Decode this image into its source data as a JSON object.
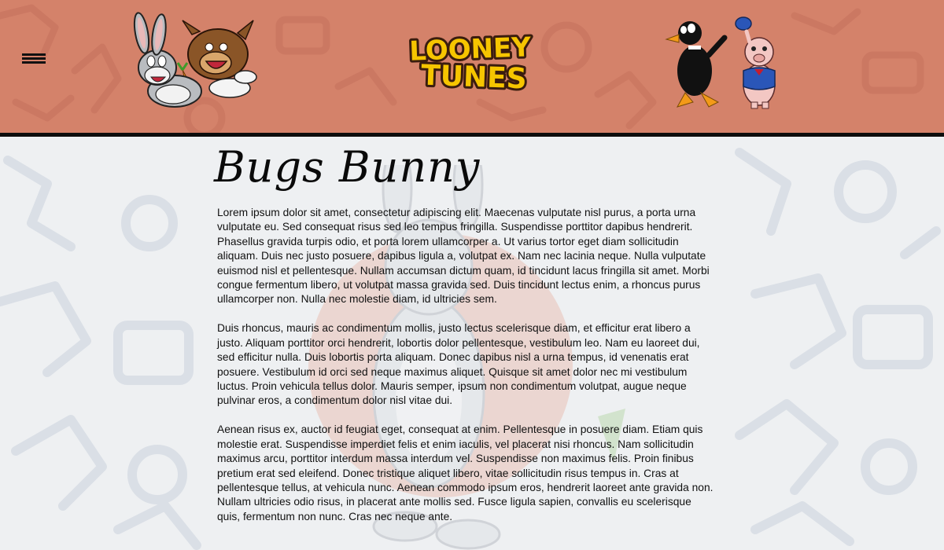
{
  "header": {
    "menu_icon": "hamburger-menu-icon",
    "logo_line1": "LOONEY",
    "logo_line2": "TUNES",
    "colors": {
      "header_bg": "#d4826a",
      "border": "#0d0d0d",
      "logo_yellow": "#f6c500",
      "logo_outline": "#3a1d0e"
    }
  },
  "main": {
    "title": "Bugs Bunny",
    "paragraphs": [
      "Lorem ipsum dolor sit amet, consectetur adipiscing elit. Maecenas vulputate nisl purus, a porta urna vulputate eu. Sed consequat risus sed leo tempus fringilla. Suspendisse porttitor dapibus hendrerit. Phasellus gravida turpis odio, et porta lorem ullamcorper a. Ut varius tortor eget diam sollicitudin aliquam. Duis nec justo posuere, dapibus ligula a, volutpat ex. Nam nec lacinia neque. Nulla vulputate euismod nisl et pellentesque. Nullam accumsan dictum quam, id tincidunt lacus fringilla sit amet. Morbi congue fermentum libero, ut volutpat massa gravida sed. Duis tincidunt lectus enim, a rhoncus purus ullamcorper non. Nulla nec molestie diam, id ultricies sem.",
      "Duis rhoncus, mauris ac condimentum mollis, justo lectus scelerisque diam, et efficitur erat libero a justo. Aliquam porttitor orci hendrerit, lobortis dolor pellentesque, vestibulum leo. Nam eu laoreet dui, sed efficitur nulla. Duis lobortis porta aliquam. Donec dapibus nisl a urna tempus, id venenatis erat posuere. Vestibulum id orci sed neque maximus aliquet. Quisque sit amet dolor nec mi vestibulum luctus. Proin vehicula tellus dolor. Mauris semper, ipsum non condimentum volutpat, augue neque pulvinar eros, a condimentum dolor nisl vitae dui.",
      "Aenean risus ex, auctor id feugiat eget, consequat at enim. Pellentesque in posuere diam. Etiam quis molestie erat. Suspendisse imperdiet felis et enim iaculis, vel placerat nisi rhoncus. Nam sollicitudin maximus arcu, porttitor interdum massa interdum vel. Suspendisse non maximus felis. Proin finibus pretium erat sed eleifend. Donec tristique aliquet libero, vitae sollicitudin risus tempus in. Cras at pellentesque tellus, at vehicula nunc. Aenean commodo ipsum eros, hendrerit laoreet ante gravida non. Nullam ultricies odio risus, in placerat ante mollis sed. Fusce ligula sapien, convallis eu scelerisque quis, fermentum non nunc. Cras nec neque ante."
    ]
  },
  "decorations": {
    "left_characters": "bugs-bunny-and-taz-illustration",
    "right_characters": "daffy-duck-and-porky-pig-illustration",
    "background_watermark": "bugs-bunny-watermark",
    "background_pattern": "cartoon-doodle-pattern"
  }
}
